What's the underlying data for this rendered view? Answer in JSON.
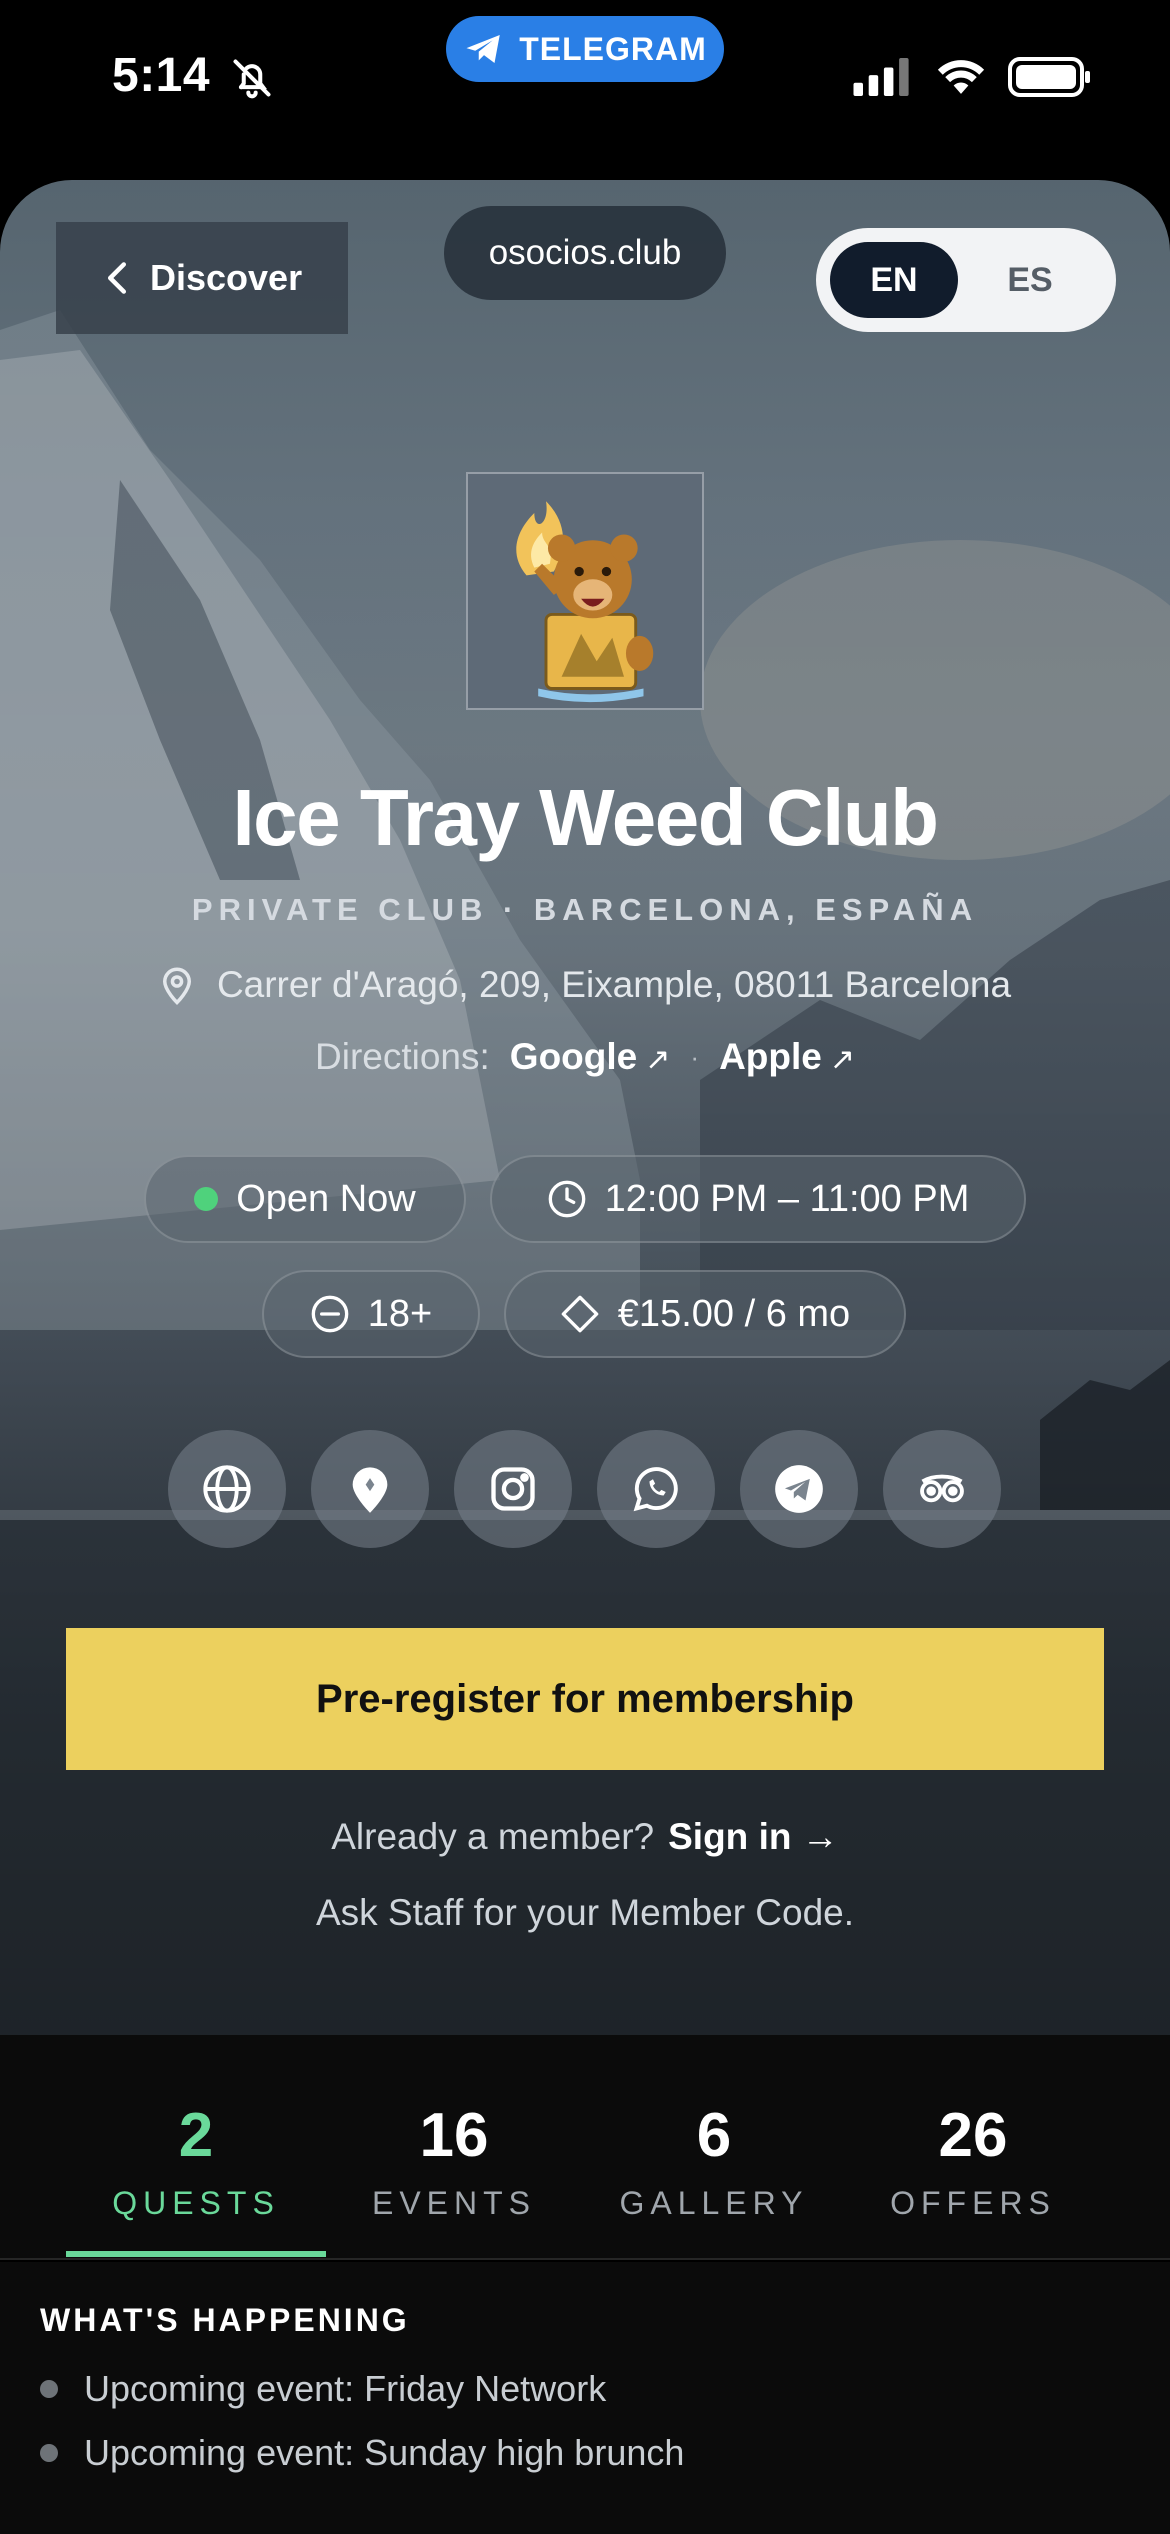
{
  "status_bar": {
    "time": "5:14",
    "banner": "TELEGRAM"
  },
  "nav": {
    "back_label": "Discover",
    "domain": "osocios.club",
    "lang_active": "EN",
    "lang_other": "ES"
  },
  "club": {
    "name": "Ice Tray Weed Club",
    "subtitle": "PRIVATE CLUB · BARCELONA, ESPAÑA",
    "address": "Carrer d'Aragó, 209, Eixample, 08011 Barcelona",
    "directions_label": "Directions:",
    "direction_google": "Google",
    "direction_apple": "Apple",
    "direction_sep": "·",
    "arrow": "↗"
  },
  "chips": {
    "open_status": "Open Now",
    "hours": "12:00 PM – 11:00 PM",
    "age": "18+",
    "price": "€15.00 / 6 mo"
  },
  "social_icons": [
    "globe-icon",
    "map-pin-icon",
    "instagram-icon",
    "whatsapp-icon",
    "telegram-icon",
    "tripadvisor-icon"
  ],
  "cta": {
    "label": "Pre-register for membership",
    "member_prompt": "Already a member?",
    "signin_label": "Sign in →",
    "staff_note": "Ask Staff for your Member Code."
  },
  "stats": [
    {
      "num": "2",
      "label": "QUESTS"
    },
    {
      "num": "16",
      "label": "EVENTS"
    },
    {
      "num": "6",
      "label": "GALLERY"
    },
    {
      "num": "26",
      "label": "OFFERS"
    }
  ],
  "happening": {
    "title": "WHAT'S HAPPENING",
    "items": [
      "Upcoming event: Friday Network",
      "Upcoming event: Sunday high brunch"
    ]
  },
  "colors": {
    "accent_green": "#6ad99a",
    "cta_yellow": "#ecd05e",
    "telegram_blue": "#2a7fe6",
    "open_dot": "#4fd27c"
  }
}
